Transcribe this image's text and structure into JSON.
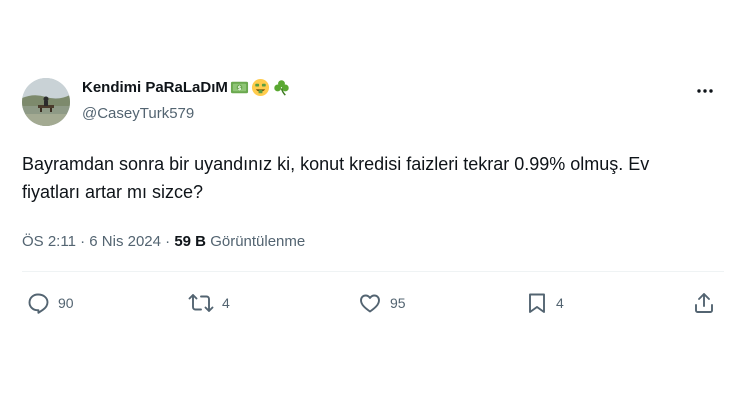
{
  "tweet": {
    "display_name": "Kendimi PaRaLaDıM",
    "name_emojis": [
      "money-icon",
      "money-mouth-face-icon",
      "shamrock-icon"
    ],
    "handle": "@CaseyTurk579",
    "text": "Bayramdan sonra bir uyandınız ki, konut kredisi faizleri tekrar 0.99% olmuş. Ev fiyatları artar mı sizce?",
    "time": "ÖS 2:11",
    "separator": "·",
    "date": "6 Nis 2024",
    "views_count": "59 B",
    "views_label": "Görüntülenme"
  },
  "actions": {
    "replies": "90",
    "retweets": "4",
    "likes": "95",
    "bookmarks": "4"
  },
  "colors": {
    "text": "#0f1419",
    "secondary": "#536471",
    "divider": "#eff3f4"
  }
}
